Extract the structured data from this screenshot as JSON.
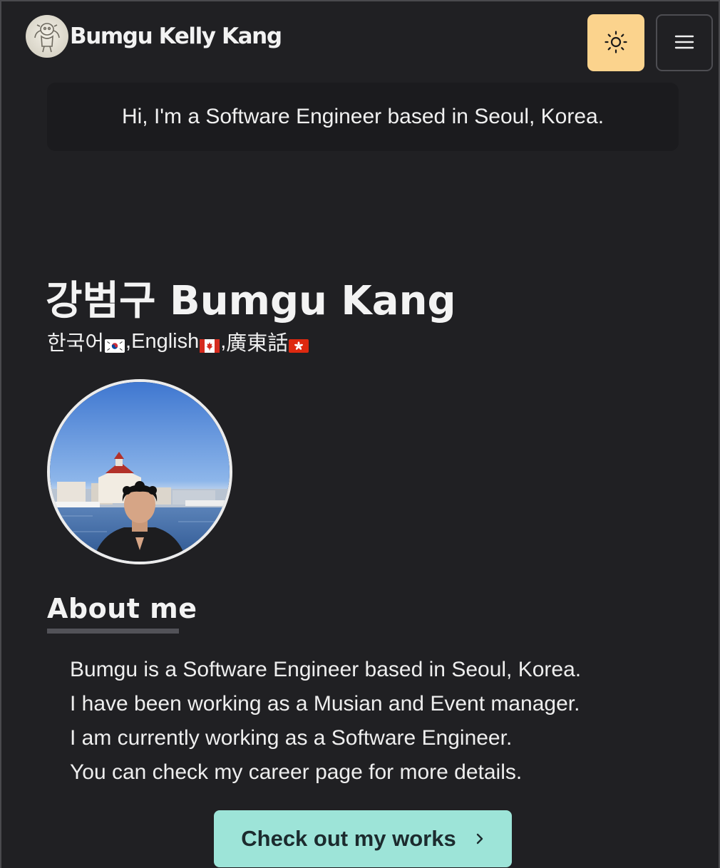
{
  "header": {
    "logo_text": "Bumgu Kelly Kang",
    "theme_toggle_icon": "sun-icon",
    "menu_icon": "hamburger-menu-icon"
  },
  "intro": {
    "text": "Hi, I'm a Software Engineer based in Seoul, Korea."
  },
  "profile": {
    "name": "강범구 Bumgu Kang",
    "languages": [
      {
        "label": "한국어",
        "flag": "south-korea-flag-icon",
        "separator": ", "
      },
      {
        "label": "English",
        "flag": "canada-flag-icon",
        "separator": ", "
      },
      {
        "label": "廣東話",
        "flag": "hong-kong-flag-icon",
        "separator": ""
      }
    ]
  },
  "about": {
    "title": "About me",
    "lines": [
      "Bumgu is a Software Engineer based in Seoul, Korea.",
      "I have been working as a Musian and Event manager.",
      "I am currently working as a Software Engineer.",
      "You can check my career page for more details."
    ],
    "cta_label": "Check out my works"
  },
  "colors": {
    "background": "#202023",
    "theme_button": "#fbd38d",
    "cta_button": "#9de4d8",
    "text": "#eeeeee"
  }
}
